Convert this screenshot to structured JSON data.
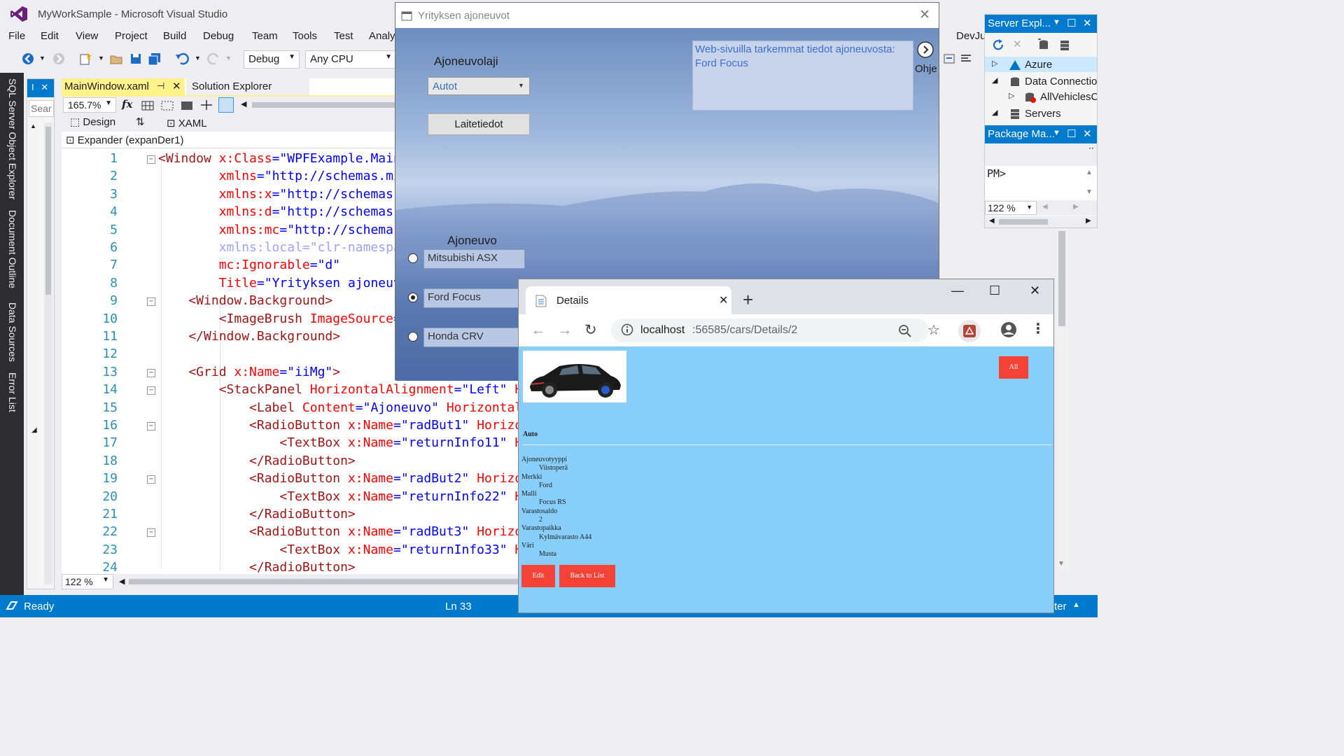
{
  "vs": {
    "title": "MyWorkSample - Microsoft Visual Studio",
    "menu": [
      "File",
      "Edit",
      "View",
      "Project",
      "Build",
      "Debug",
      "Team",
      "Tools",
      "Test",
      "Analy",
      "DevJu"
    ],
    "toolbar": {
      "config": "Debug",
      "platform": "Any CPU"
    },
    "left_tabs": [
      "SQL Server Object Explorer",
      "Document Outline",
      "Data Sources",
      "Error List"
    ],
    "toolbox": {
      "search_placeholder": "Searc"
    },
    "tabs": {
      "main": "MainWindow.xaml",
      "solution": "Solution Explorer"
    },
    "zoom": "165.7%",
    "fx": "fx",
    "design_tab": "Design",
    "xaml_tab": "XAML",
    "expander": "Expander (expanDer1)",
    "code_zoom": "122 %",
    "status": {
      "ready": "Ready",
      "line": "Ln 33",
      "right": "ter"
    },
    "code_lines": [
      {
        "n": "1",
        "fold": "−",
        "parts": [
          [
            "t",
            "<Window "
          ],
          [
            "a",
            "x:Class"
          ],
          [
            "p",
            "="
          ],
          [
            "v",
            "\"WPFExample.Main"
          ]
        ]
      },
      {
        "n": "2",
        "parts": [
          [
            "a",
            "        xmlns"
          ],
          [
            "p",
            "="
          ],
          [
            "v",
            "\"http://schemas.mi"
          ]
        ]
      },
      {
        "n": "3",
        "parts": [
          [
            "a",
            "        xmlns:x"
          ],
          [
            "p",
            "="
          ],
          [
            "v",
            "\"http://schemas."
          ]
        ]
      },
      {
        "n": "4",
        "parts": [
          [
            "a",
            "        xmlns:d"
          ],
          [
            "p",
            "="
          ],
          [
            "v",
            "\"http://schemas."
          ]
        ]
      },
      {
        "n": "5",
        "parts": [
          [
            "a",
            "        xmlns:mc"
          ],
          [
            "p",
            "="
          ],
          [
            "v",
            "\"http://schemas"
          ]
        ]
      },
      {
        "n": "6",
        "parts": [
          [
            "ml",
            "        xmlns:local=\"clr-namespa"
          ]
        ]
      },
      {
        "n": "7",
        "parts": [
          [
            "a",
            "        mc:Ignorable"
          ],
          [
            "p",
            "="
          ],
          [
            "v",
            "\"d\""
          ]
        ]
      },
      {
        "n": "8",
        "parts": [
          [
            "a",
            "        Title"
          ],
          [
            "p",
            "="
          ],
          [
            "v",
            "\"Yrityksen ajoneuv"
          ]
        ]
      },
      {
        "n": "9",
        "fold": "−",
        "parts": [
          [
            "t",
            "    <Window.Background>"
          ]
        ]
      },
      {
        "n": "10",
        "parts": [
          [
            "t",
            "        <ImageBrush "
          ],
          [
            "a",
            "ImageSource"
          ],
          [
            "p",
            "="
          ]
        ]
      },
      {
        "n": "11",
        "parts": [
          [
            "t",
            "    </Window.Background>"
          ]
        ]
      },
      {
        "n": "12",
        "parts": []
      },
      {
        "n": "13",
        "fold": "−",
        "parts": [
          [
            "t",
            "    <Grid "
          ],
          [
            "a",
            "x:Name"
          ],
          [
            "p",
            "="
          ],
          [
            "v",
            "\"iiMg\""
          ],
          [
            "t",
            ">"
          ]
        ]
      },
      {
        "n": "14",
        "fold": "−",
        "parts": [
          [
            "t",
            "        <StackPanel "
          ],
          [
            "a",
            "HorizontalAlignment"
          ],
          [
            "p",
            "="
          ],
          [
            "v",
            "\"Left\""
          ],
          [
            "a",
            " H"
          ]
        ]
      },
      {
        "n": "15",
        "parts": [
          [
            "t",
            "            <Label "
          ],
          [
            "a",
            "Content"
          ],
          [
            "p",
            "="
          ],
          [
            "v",
            "\"Ajoneuvo\""
          ],
          [
            "a",
            " Horizontal"
          ]
        ]
      },
      {
        "n": "16",
        "fold": "−",
        "parts": [
          [
            "t",
            "            <RadioButton "
          ],
          [
            "a",
            "x:Name"
          ],
          [
            "p",
            "="
          ],
          [
            "v",
            "\"radBut1\""
          ],
          [
            "a",
            " Horizo"
          ]
        ]
      },
      {
        "n": "17",
        "parts": [
          [
            "t",
            "                <TextBox "
          ],
          [
            "a",
            "x:Name"
          ],
          [
            "p",
            "="
          ],
          [
            "v",
            "\"returnInfo11\""
          ],
          [
            "a",
            " H"
          ]
        ]
      },
      {
        "n": "18",
        "parts": [
          [
            "t",
            "            </RadioButton>"
          ]
        ]
      },
      {
        "n": "19",
        "fold": "−",
        "parts": [
          [
            "t",
            "            <RadioButton "
          ],
          [
            "a",
            "x:Name"
          ],
          [
            "p",
            "="
          ],
          [
            "v",
            "\"radBut2\""
          ],
          [
            "a",
            " Horizo"
          ]
        ]
      },
      {
        "n": "20",
        "parts": [
          [
            "t",
            "                <TextBox "
          ],
          [
            "a",
            "x:Name"
          ],
          [
            "p",
            "="
          ],
          [
            "v",
            "\"returnInfo22\""
          ],
          [
            "a",
            " H"
          ]
        ]
      },
      {
        "n": "21",
        "parts": [
          [
            "t",
            "            </RadioButton>"
          ]
        ]
      },
      {
        "n": "22",
        "fold": "−",
        "parts": [
          [
            "t",
            "            <RadioButton "
          ],
          [
            "a",
            "x:Name"
          ],
          [
            "p",
            "="
          ],
          [
            "v",
            "\"radBut3\""
          ],
          [
            "a",
            " Horizo"
          ]
        ]
      },
      {
        "n": "23",
        "parts": [
          [
            "t",
            "                <TextBox "
          ],
          [
            "a",
            "x:Name"
          ],
          [
            "p",
            "="
          ],
          [
            "v",
            "\"returnInfo33\""
          ],
          [
            "a",
            " H"
          ]
        ]
      },
      {
        "n": "24",
        "parts": [
          [
            "t",
            "            </RadioButton>"
          ]
        ]
      }
    ]
  },
  "wpf": {
    "title": "Yrityksen ajoneuvot",
    "type_label": "Ajoneuvolaji",
    "type_value": "Autot",
    "device_button": "Laitetiedot",
    "info_text": "Web-sivuilla tarkemmat tiedot ajoneuvosta: Ford Focus",
    "help_label": "Ohje",
    "vehicle_label": "Ajoneuvo",
    "vehicles": [
      {
        "name": "Mitsubishi ASX",
        "selected": false
      },
      {
        "name": "Ford Focus",
        "selected": true
      },
      {
        "name": "Honda CRV",
        "selected": false
      }
    ]
  },
  "server_explorer": {
    "title": "Server Expl...",
    "items": [
      "Azure",
      "Data Connectior",
      "AllVehiclesCo",
      "Servers"
    ],
    "package_title": "Package Ma...",
    "prompt": "PM>",
    "zoom": "122 %"
  },
  "browser": {
    "tab_title": "Details",
    "url_host": "localhost",
    "url_rest": ":56585/cars/Details/2",
    "all_button": "All",
    "section": "Auto",
    "fields": [
      {
        "label": "Ajoneuvotyyppi",
        "value": "Viistoperä"
      },
      {
        "label": "Merkki",
        "value": "Ford"
      },
      {
        "label": "Malli",
        "value": "Focus RS"
      },
      {
        "label": "Varastosaldo",
        "value": "2"
      },
      {
        "label": "Varastopaikka",
        "value": "Kylmävarasto A44"
      },
      {
        "label": "Väri",
        "value": "Musta"
      }
    ],
    "edit_button": "Edit",
    "back_button": "Back to List"
  }
}
